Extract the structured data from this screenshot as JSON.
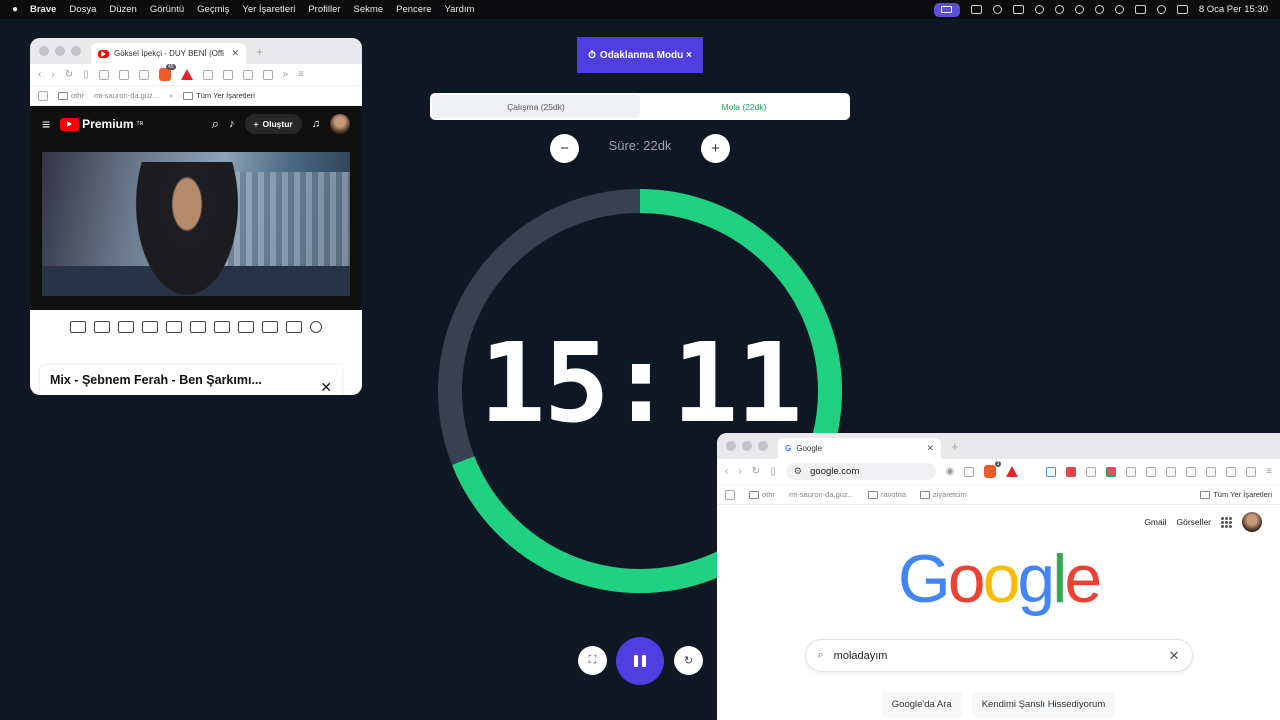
{
  "menubar": {
    "apple": "",
    "items": [
      "Brave",
      "Dosya",
      "Düzen",
      "Görüntü",
      "Geçmiş",
      "Yer İşaretleri",
      "Profiller",
      "Sekme",
      "Pencere",
      "Yardım"
    ],
    "clock": "8 Oca Per  15:30"
  },
  "focus": {
    "label": "Odaklanma Modu ×"
  },
  "timer": {
    "tabs": [
      "Çalışma (25dk)",
      "Mola (22dk)"
    ],
    "active_tab": "Mola (22dk)",
    "minus": "−",
    "plus": "+",
    "duration": "Süre: 22dk",
    "time": "15:11",
    "progress": 0.69,
    "colors": {
      "ring": "#1fd180",
      "track": "#374151",
      "accent": "#4f3fe0"
    }
  },
  "yt_window": {
    "tab_title": "Göksel İpekçi - DUY BENİ (Offi",
    "bookmarks": [
      "othr",
      "mt-sauron-da.guz...",
      "»",
      "Tüm Yer İşaretleri"
    ],
    "brave_badge": "45",
    "logo_text": "Premium",
    "logo_sup": "TR",
    "create": "Oluştur",
    "card_title": "Mix - Şebnem Ferah - Ben Şarkımı..."
  },
  "google_window": {
    "tab_title": "Google",
    "url": "google.com",
    "brave_badge": "3",
    "bookmarks": [
      "othr",
      "mt-sauron-da.guz...",
      "ravotna",
      "ziyaretcim",
      "Tüm Yer İşaretleri"
    ],
    "links": [
      "Gmail",
      "Görseller"
    ],
    "search_value": "moladayım",
    "buttons": [
      "Google'da Ara",
      "Kendimi Şanslı Hissediyorum"
    ]
  }
}
